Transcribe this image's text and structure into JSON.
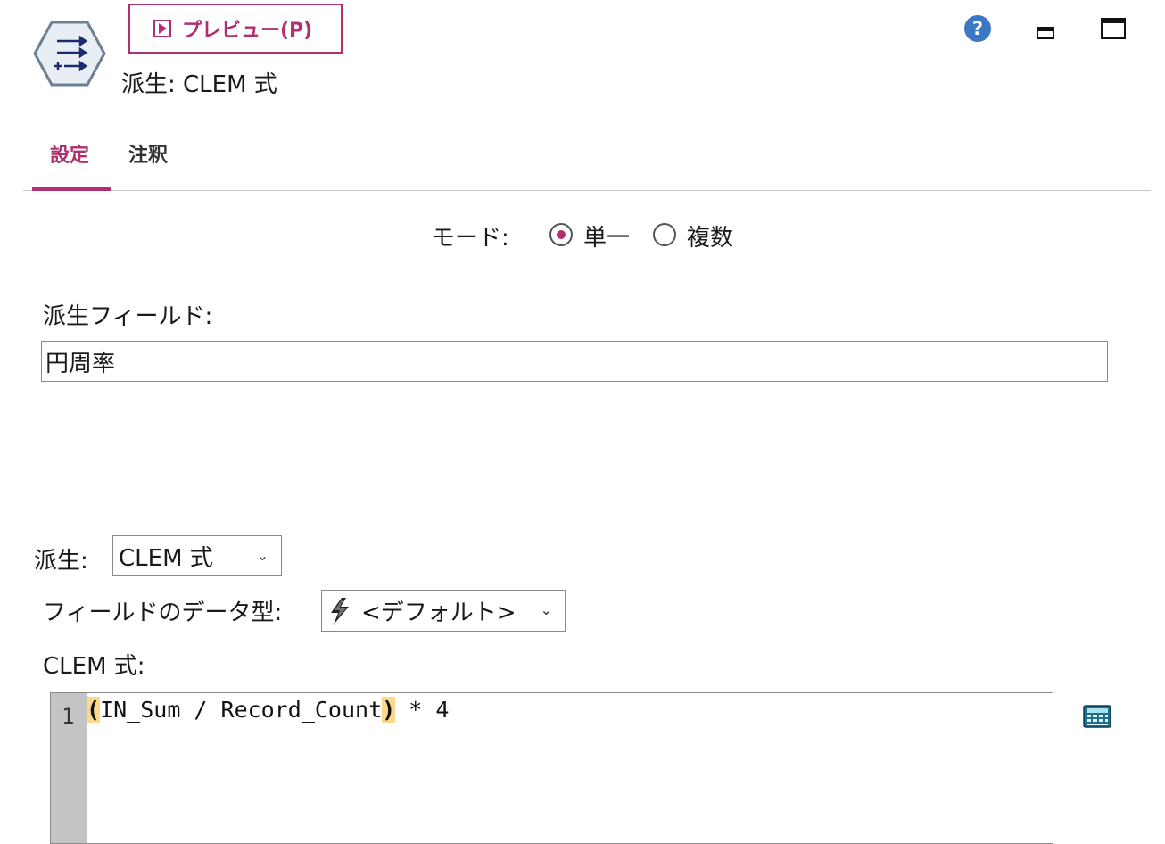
{
  "header": {
    "preview_label": "プレビュー(P)",
    "node_title": "派生: CLEM 式"
  },
  "tabs": [
    {
      "label": "設定",
      "active": true
    },
    {
      "label": "注釈",
      "active": false
    }
  ],
  "mode": {
    "label": "モード:",
    "options": [
      "単一",
      "複数"
    ],
    "selected": "単一"
  },
  "derive_field": {
    "label": "派生フィールド:",
    "value": "円周率"
  },
  "derive_as": {
    "label": "派生:",
    "selected": "CLEM 式"
  },
  "field_type": {
    "label": "フィールドのデータ型:",
    "selected": "<デフォルト>"
  },
  "clem": {
    "label": "CLEM 式:",
    "line_number": "1",
    "tokens": {
      "open_paren": "(",
      "middle": "IN_Sum / Record_Count",
      "close_paren": ")",
      "tail": " * 4"
    }
  },
  "colors": {
    "accent": "#b0306f",
    "help_blue": "#3a78c4",
    "bracket_highlight": "#fcd98a"
  },
  "icons": [
    "derive-node-icon",
    "play-icon",
    "help-icon",
    "minimize-icon",
    "maximize-icon",
    "bolt-icon",
    "calculator-icon"
  ]
}
